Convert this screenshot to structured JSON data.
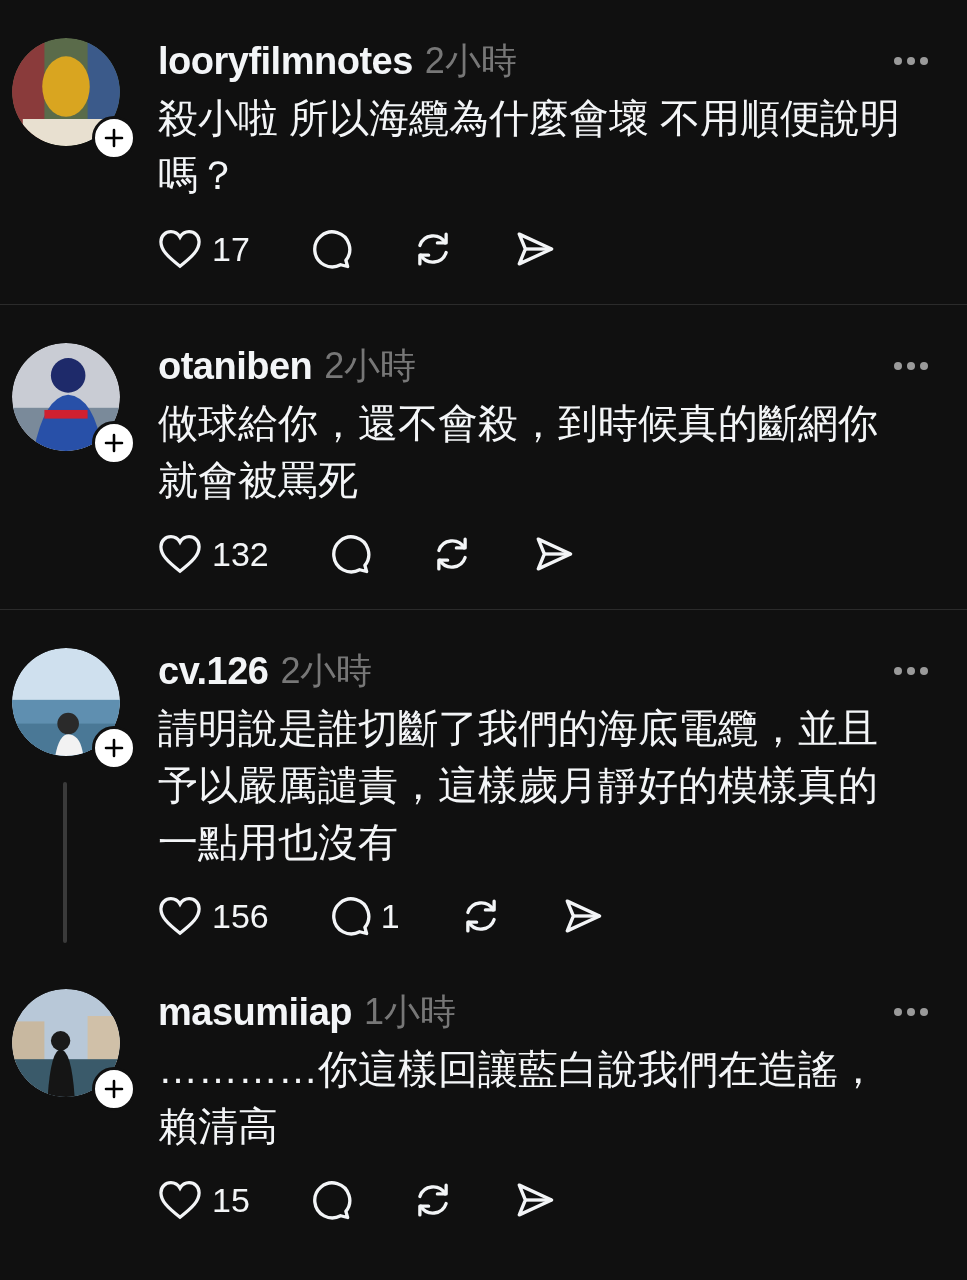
{
  "posts": [
    {
      "username": "looryfilmnotes",
      "time": "2小時",
      "text": "殺小啦 所以海纜為什麼會壞 不用順便說明嗎？",
      "likes": "17",
      "thread_line": false
    },
    {
      "username": "otaniben",
      "time": "2小時",
      "text": "做球給你，還不會殺，到時候真的斷網你就會被罵死",
      "likes": "132",
      "thread_line": false
    },
    {
      "username": "cv.126",
      "time": "2小時",
      "text": "請明說是誰切斷了我們的海底電纜，並且予以嚴厲譴責，這樣歲月靜好的模樣真的一點用也沒有",
      "likes": "156",
      "replies": "1",
      "thread_line": true
    },
    {
      "username": "masumiiap",
      "time": "1小時",
      "text": "…………你這樣回讓藍白說我們在造謠，賴清高",
      "likes": "15",
      "thread_line": false
    }
  ]
}
